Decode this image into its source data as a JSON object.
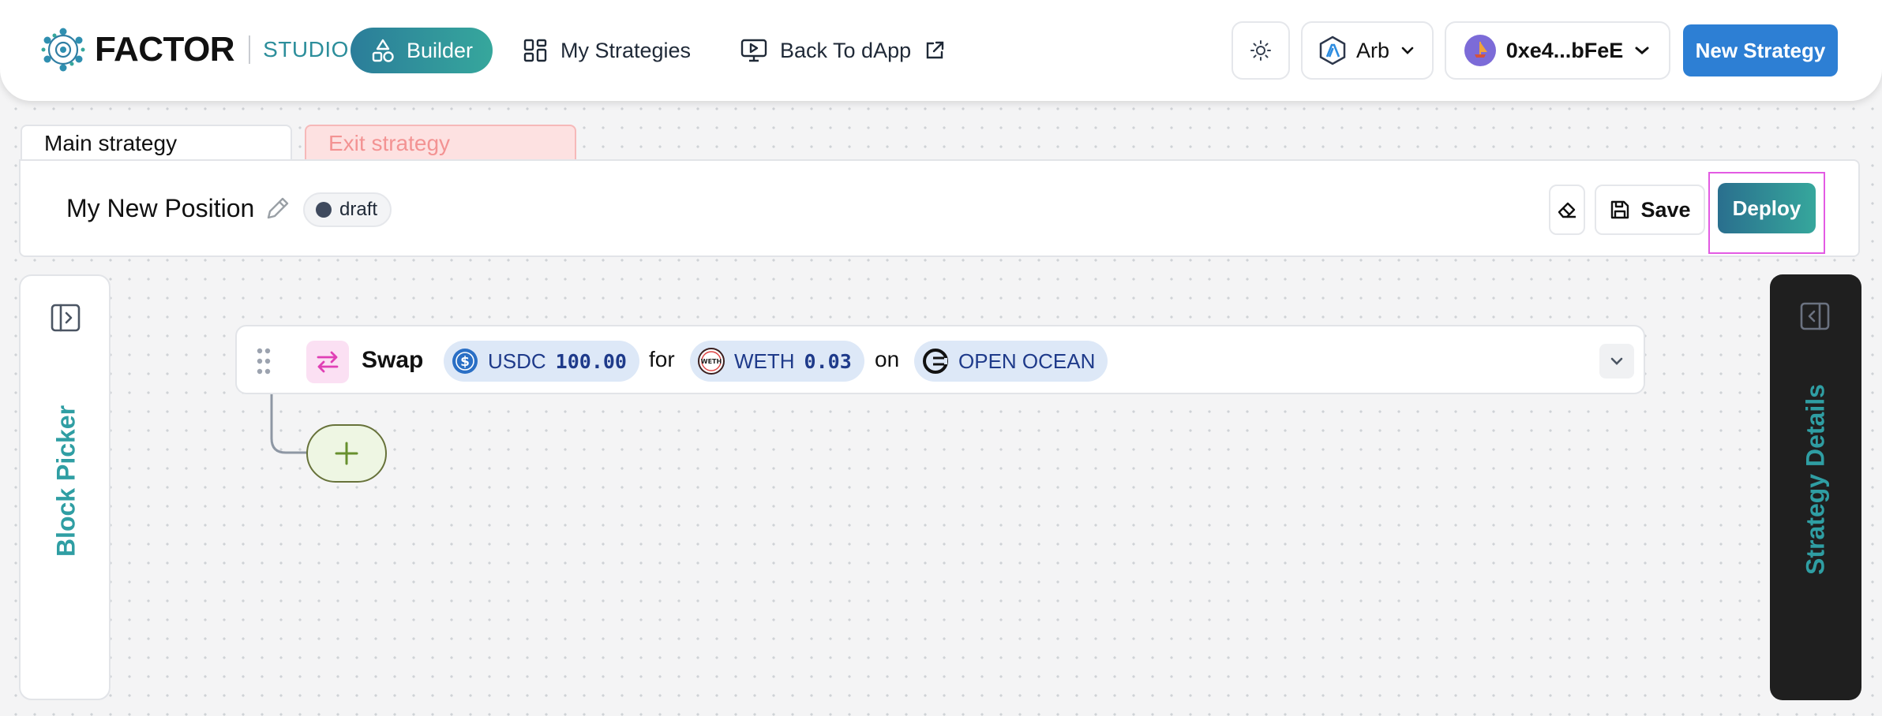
{
  "header": {
    "logo_text": "FACTOR",
    "logo_sub": "STUDIO",
    "nav": {
      "builder": "Builder",
      "my_strategies": "My Strategies",
      "back_to_dapp": "Back To dApp"
    },
    "network": "Arb",
    "wallet": "0xe4...bFeE",
    "new_strategy": "New Strategy",
    "icons": {
      "theme": "sun-icon",
      "network": "arbitrum-icon",
      "wallet": "avatar-icon"
    }
  },
  "tabs": {
    "main": "Main strategy",
    "exit": "Exit strategy"
  },
  "toolbar": {
    "title": "My New Position",
    "status": "draft",
    "save": "Save",
    "deploy": "Deploy"
  },
  "panels": {
    "left": "Block Picker",
    "right": "Strategy Details"
  },
  "block": {
    "action": "Swap",
    "from_token": "USDC",
    "from_amount": "100.00",
    "word_for": "for",
    "to_token": "WETH",
    "to_amount": "0.03",
    "word_on": "on",
    "protocol": "OPEN OCEAN"
  },
  "colors": {
    "accent_teal": "#2f9ea3",
    "primary_blue": "#2d7fd4",
    "exit_tab_bg": "#fde1e1",
    "swap_icon_pink": "#e040b5"
  }
}
